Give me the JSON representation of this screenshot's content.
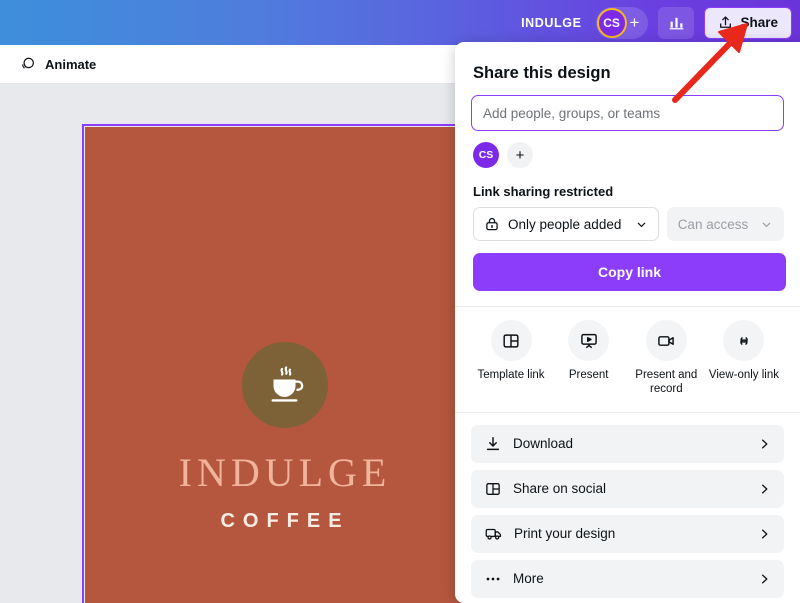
{
  "topbar": {
    "doc_title": "INDULGE",
    "avatar_initials": "CS",
    "add_member_label": "+",
    "insights_icon": "bar-chart-icon",
    "share_label": "Share",
    "share_icon": "upload-icon"
  },
  "toolbar": {
    "animate_label": "Animate",
    "animate_icon": "animate-circles-icon"
  },
  "canvas": {
    "brand_name": "INDULGE",
    "brand_sub": "COFFEE",
    "logo_icon": "coffee-cup-icon",
    "page_color": "#b5573e",
    "logo_circle_color": "#7e6237",
    "selection_color": "#8b3dfa"
  },
  "dialog": {
    "title": "Share this design",
    "input_placeholder": "Add people, groups, or teams",
    "input_value": "",
    "chips": [
      {
        "initials": "CS",
        "name": "member-avatar"
      },
      {
        "initials": "+",
        "name": "add-member"
      }
    ],
    "link_section_label": "Link sharing restricted",
    "access_select": {
      "label": "Only people added",
      "icon": "lock-icon"
    },
    "permission_select": {
      "label": "Can access",
      "disabled": true
    },
    "copy_link_label": "Copy link",
    "quick_actions": [
      {
        "label": "Template link",
        "icon": "template-link-icon"
      },
      {
        "label": "Present",
        "icon": "present-icon"
      },
      {
        "label": "Present and record",
        "icon": "video-record-icon"
      },
      {
        "label": "View-only link",
        "icon": "link-chain-icon"
      }
    ],
    "menu_items": [
      {
        "label": "Download",
        "icon": "download-icon"
      },
      {
        "label": "Share on social",
        "icon": "social-grid-icon"
      },
      {
        "label": "Print your design",
        "icon": "truck-icon"
      },
      {
        "label": "More",
        "icon": "ellipsis-icon"
      }
    ]
  },
  "annotation": {
    "arrow_color": "#e8281b",
    "arrow_icon": "red-arrow-icon"
  }
}
